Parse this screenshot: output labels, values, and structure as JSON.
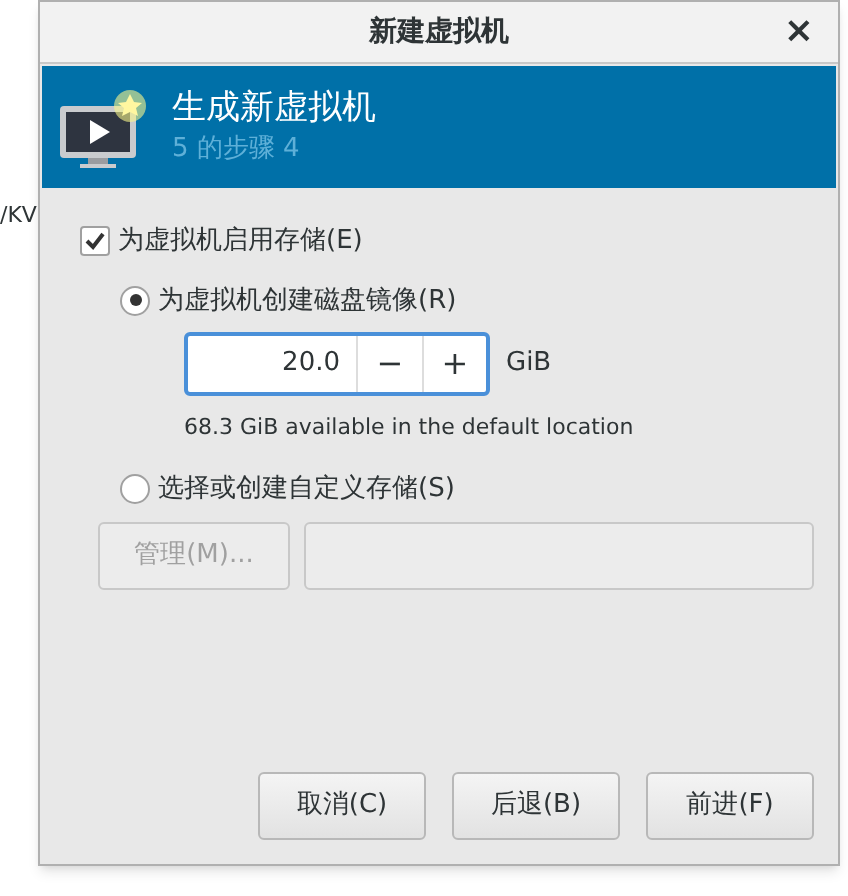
{
  "background_window": {
    "text": "/KV"
  },
  "window": {
    "title": "新建虚拟机",
    "close": "×"
  },
  "header": {
    "title": "生成新虚拟机",
    "step": "5 的步骤 4"
  },
  "enable_storage": {
    "label": "为虚拟机启用存储(E)",
    "checked": true
  },
  "options": [
    {
      "kind": "disk",
      "label": "为虚拟机创建磁盘镜像(R)",
      "selected": true
    },
    {
      "kind": "custom",
      "label": "选择或创建自定义存储(S)",
      "selected": false
    }
  ],
  "disk_size": {
    "value": "20.0",
    "minus": "−",
    "plus": "+",
    "unit": "GiB",
    "available": "68.3 GiB available in the default location"
  },
  "custom": {
    "manage_button": "管理(M)...",
    "disabled": true
  },
  "buttons": [
    {
      "label": "取消(C)"
    },
    {
      "label": "后退(B)"
    },
    {
      "label": "前进(F)"
    }
  ]
}
